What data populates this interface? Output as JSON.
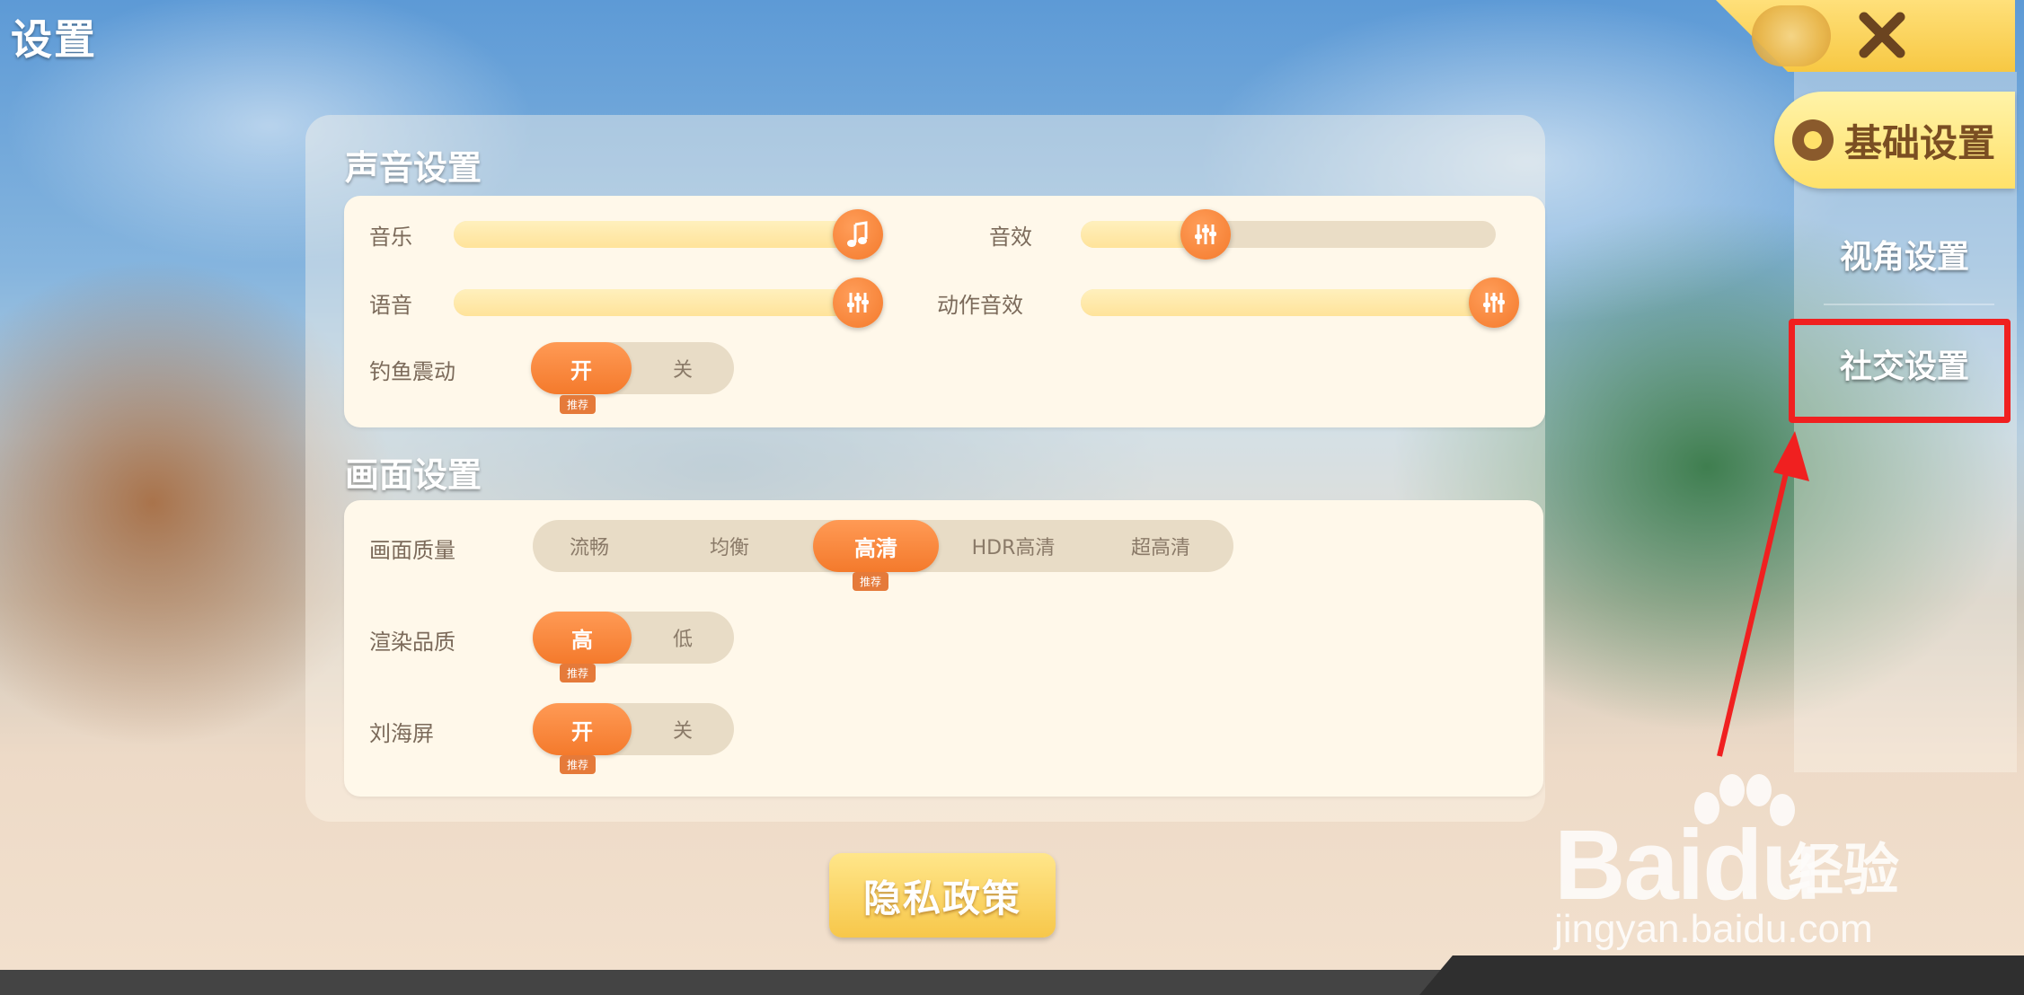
{
  "page_title": "设置",
  "sidebar": {
    "tabs": [
      {
        "label": "基础设置",
        "icon": "paw-icon",
        "active": true
      },
      {
        "label": "视角设置",
        "active": false
      },
      {
        "label": "社交设置",
        "active": false,
        "highlighted": true
      }
    ],
    "close_icon": "close-icon"
  },
  "sound": {
    "title": "声音设置",
    "sliders": [
      {
        "label": "音乐",
        "value": 100,
        "icon": "music-note-icon"
      },
      {
        "label": "音效",
        "value": 30,
        "icon": "sliders-icon"
      },
      {
        "label": "语音",
        "value": 100,
        "icon": "sliders-icon"
      },
      {
        "label": "动作音效",
        "value": 100,
        "icon": "sliders-icon"
      }
    ],
    "fishing_vibration": {
      "label": "钓鱼震动",
      "on": "开",
      "off": "关",
      "selected": "开",
      "badge": "推荐"
    }
  },
  "display": {
    "title": "画面设置",
    "quality": {
      "label": "画面质量",
      "options": [
        "流畅",
        "均衡",
        "高清",
        "HDR高清",
        "超高清"
      ],
      "selected": "高清",
      "badge": "推荐"
    },
    "render": {
      "label": "渲染品质",
      "on": "高",
      "off": "低",
      "selected": "高",
      "badge": "推荐"
    },
    "notch": {
      "label": "刘海屏",
      "on": "开",
      "off": "关",
      "selected": "开",
      "badge": "推荐"
    }
  },
  "privacy_button": "隐私政策",
  "watermark": {
    "brand": "Bai",
    "brand_du": "du",
    "brand_sub": "经验",
    "url": "jingyan.baidu.com"
  },
  "colors": {
    "accent": "#f47a2c",
    "tab_yellow": "#ffe16a",
    "highlight_red": "#f02020"
  }
}
